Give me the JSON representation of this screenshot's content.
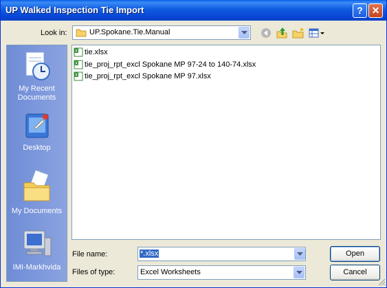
{
  "window": {
    "title": "UP Walked Inspection Tie Import",
    "help_glyph": "?",
    "close_glyph": "✕"
  },
  "lookin": {
    "label": "Look in:",
    "value": "UP.Spokane.Tie.Manual"
  },
  "toolbar": {
    "icons": [
      "back-icon",
      "up-folder-icon",
      "new-folder-icon",
      "views-menu-icon"
    ]
  },
  "places": [
    {
      "label_line1": "My Recent",
      "label_line2": "Documents",
      "icon": "recent-documents-icon"
    },
    {
      "label_line1": "Desktop",
      "label_line2": "",
      "icon": "desktop-icon"
    },
    {
      "label_line1": "My Documents",
      "label_line2": "",
      "icon": "my-documents-icon"
    },
    {
      "label_line1": "IMI-Markhvida",
      "label_line2": "",
      "icon": "computer-icon"
    }
  ],
  "files": [
    {
      "name": "tie.xlsx"
    },
    {
      "name": "tie_proj_rpt_excl Spokane MP 97-24 to 140-74.xlsx"
    },
    {
      "name": "tie_proj_rpt_excl Spokane MP 97.xlsx"
    }
  ],
  "filename": {
    "label": "File name:",
    "value": "*.xlsx"
  },
  "filetype": {
    "label": "Files of type:",
    "value": "Excel Worksheets"
  },
  "buttons": {
    "open": "Open",
    "cancel": "Cancel"
  },
  "colors": {
    "title_bar": "#0A5FE8",
    "places_bar": "#7B96D9",
    "selection": "#316AC5",
    "window_bg": "#ECE9D8"
  }
}
